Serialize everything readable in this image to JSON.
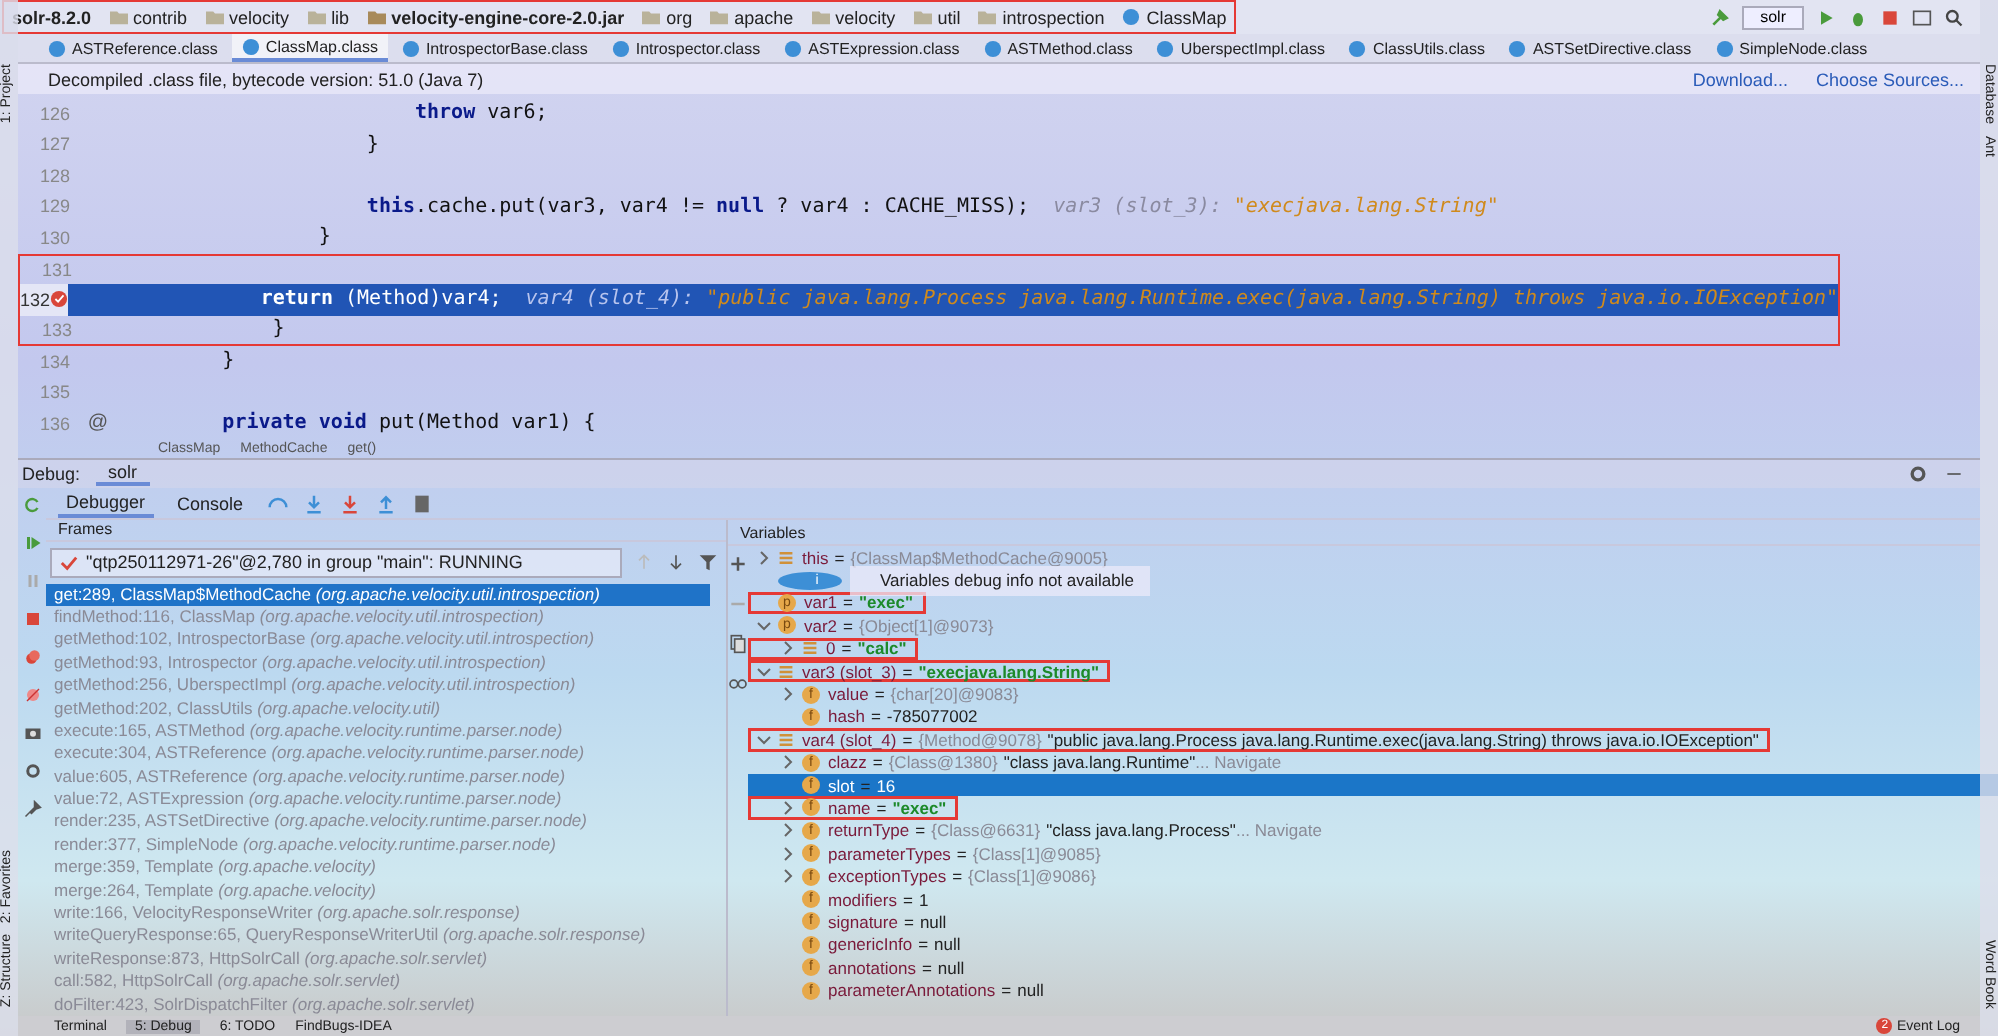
{
  "breadcrumbs": [
    {
      "label": "solr-8.2.0",
      "kind": "project"
    },
    {
      "label": "contrib",
      "kind": "folder"
    },
    {
      "label": "velocity",
      "kind": "folder"
    },
    {
      "label": "lib",
      "kind": "folder"
    },
    {
      "label": "velocity-engine-core-2.0.jar",
      "kind": "jar"
    },
    {
      "label": "org",
      "kind": "folder"
    },
    {
      "label": "apache",
      "kind": "folder"
    },
    {
      "label": "velocity",
      "kind": "folder"
    },
    {
      "label": "util",
      "kind": "folder"
    },
    {
      "label": "introspection",
      "kind": "folder"
    },
    {
      "label": "ClassMap",
      "kind": "class"
    }
  ],
  "breadcrumbs_highlighted": true,
  "run_config": "solr",
  "tabs": [
    {
      "label": "ASTReference.class",
      "selected": false
    },
    {
      "label": "ClassMap.class",
      "selected": true
    },
    {
      "label": "IntrospectorBase.class",
      "selected": false
    },
    {
      "label": "Introspector.class",
      "selected": false
    },
    {
      "label": "ASTExpression.class",
      "selected": false
    },
    {
      "label": "ASTMethod.class",
      "selected": false
    },
    {
      "label": "UberspectImpl.class",
      "selected": false
    },
    {
      "label": "ClassUtils.class",
      "selected": false
    },
    {
      "label": "ASTSetDirective.class",
      "selected": false
    },
    {
      "label": "SimpleNode.class",
      "selected": false
    }
  ],
  "info_bar": {
    "message": "Decompiled .class file, bytecode version: 51.0 (Java 7)",
    "links": [
      "Download...",
      "Choose Sources..."
    ]
  },
  "code_lines": [
    {
      "number": "126",
      "code": "                        **throw** var6;",
      "current": false
    },
    {
      "number": "127",
      "code": "                    }",
      "current": false
    },
    {
      "number": "128",
      "current": false
    },
    {
      "number": "129",
      "code": "                    **this**.cache.put(var3, var4 != **null** ? var4 : CACHE_MISS);",
      "hint_label": "var3 (slot_3):",
      "hint_value": "\"execjava.lang.String\"",
      "current": false
    },
    {
      "number": "130",
      "code": "                }",
      "current": false
    },
    {
      "number": "131",
      "current": false,
      "highlighted": true
    },
    {
      "number": "132",
      "code": "                **return** (Method)var4;",
      "hint_label": "var4 (slot_4):",
      "hint_value": "\"public java.lang.Process java.lang.Runtime.exec(java.lang.String) throws java.io.IOException\"",
      "current": true,
      "breakpoint": true,
      "highlighted": true
    },
    {
      "number": "133",
      "code": "            }",
      "current": false,
      "highlighted": true
    },
    {
      "number": "134",
      "code": "        }",
      "current": false
    },
    {
      "number": "135",
      "current": false
    },
    {
      "number": "136",
      "code": "        **private void** put(Method var1) {",
      "gutter_mark": "@",
      "current": false
    }
  ],
  "editor_path": [
    "ClassMap",
    "MethodCache",
    "get()"
  ],
  "debug": {
    "title": "Debug:",
    "session": "solr",
    "tabs": [
      {
        "label": "Debugger",
        "selected": true
      },
      {
        "label": "Console",
        "selected": false
      }
    ]
  },
  "frames": {
    "header": "Frames",
    "thread": "\"qtp250112971-26\"@2,780 in group \"main\": RUNNING",
    "items": [
      {
        "method": "get:289, ClassMap$MethodCache",
        "package": "(org.apache.velocity.util.introspection)",
        "selected": true
      },
      {
        "method": "findMethod:116, ClassMap",
        "package": "(org.apache.velocity.util.introspection)",
        "selected": false
      },
      {
        "method": "getMethod:102, IntrospectorBase",
        "package": "(org.apache.velocity.util.introspection)",
        "selected": false
      },
      {
        "method": "getMethod:93, Introspector",
        "package": "(org.apache.velocity.util.introspection)",
        "selected": false
      },
      {
        "method": "getMethod:256, UberspectImpl",
        "package": "(org.apache.velocity.util.introspection)",
        "selected": false
      },
      {
        "method": "getMethod:202, ClassUtils",
        "package": "(org.apache.velocity.util)",
        "selected": false
      },
      {
        "method": "execute:165, ASTMethod",
        "package": "(org.apache.velocity.runtime.parser.node)",
        "selected": false
      },
      {
        "method": "execute:304, ASTReference",
        "package": "(org.apache.velocity.runtime.parser.node)",
        "selected": false
      },
      {
        "method": "value:605, ASTReference",
        "package": "(org.apache.velocity.runtime.parser.node)",
        "selected": false
      },
      {
        "method": "value:72, ASTExpression",
        "package": "(org.apache.velocity.runtime.parser.node)",
        "selected": false
      },
      {
        "method": "render:235, ASTSetDirective",
        "package": "(org.apache.velocity.runtime.parser.node)",
        "selected": false
      },
      {
        "method": "render:377, SimpleNode",
        "package": "(org.apache.velocity.runtime.parser.node)",
        "selected": false
      },
      {
        "method": "merge:359, Template",
        "package": "(org.apache.velocity)",
        "selected": false
      },
      {
        "method": "merge:264, Template",
        "package": "(org.apache.velocity)",
        "selected": false
      },
      {
        "method": "write:166, VelocityResponseWriter",
        "package": "(org.apache.solr.response)",
        "selected": false
      },
      {
        "method": "writeQueryResponse:65, QueryResponseWriterUtil",
        "package": "(org.apache.solr.response)",
        "selected": false
      },
      {
        "method": "writeResponse:873, HttpSolrCall",
        "package": "(org.apache.solr.servlet)",
        "selected": false
      },
      {
        "method": "call:582, HttpSolrCall",
        "package": "(org.apache.solr.servlet)",
        "selected": false
      },
      {
        "method": "doFilter:423, SolrDispatchFilter",
        "package": "(org.apache.solr.servlet)",
        "selected": false
      }
    ]
  },
  "variables": {
    "header": "Variables",
    "items": [
      {
        "kind": "object",
        "name": "this",
        "eq": "=",
        "ref": "{ClassMap$MethodCache@9005}",
        "expanded": false,
        "selected": false,
        "highlighted": false
      },
      {
        "kind": "info",
        "badge": "i",
        "name": "Variables debug info not available",
        "selected": false,
        "highlighted": false
      },
      {
        "kind": "param",
        "badge": "p",
        "name": "var1",
        "eq": "=",
        "value": "\"exec\"",
        "quoted_string": true,
        "selected": false,
        "highlighted": true
      },
      {
        "kind": "param",
        "badge": "p",
        "name": "var2",
        "eq": "=",
        "ref": "{Object[1]@9073}",
        "expanded": true,
        "selected": false,
        "highlighted": false,
        "children": [
          {
            "kind": "object",
            "name": "0",
            "eq": "=",
            "value": "\"calc\"",
            "quoted_string": true,
            "expanded": false,
            "selected": false,
            "highlighted": true
          }
        ]
      },
      {
        "kind": "object",
        "name": "var3 (slot_3)",
        "eq": "=",
        "value": "\"execjava.lang.String\"",
        "quoted_string": true,
        "expanded": true,
        "selected": false,
        "highlighted": true,
        "children": [
          {
            "kind": "field",
            "badge": "f",
            "name": "value",
            "eq": "=",
            "ref": "{char[20]@9083}",
            "expanded": false,
            "selected": false,
            "highlighted": false
          },
          {
            "kind": "field",
            "badge": "f",
            "name": "hash",
            "eq": "=",
            "value": "-785077002",
            "quoted_string": false,
            "selected": false,
            "highlighted": false
          }
        ]
      },
      {
        "kind": "object",
        "name": "var4 (slot_4)",
        "eq": "=",
        "ref": "{Method@9078}",
        "value": "\"public java.lang.Process java.lang.Runtime.exec(java.lang.String) throws java.io.IOException\"",
        "quoted_string": false,
        "expanded": true,
        "selected": false,
        "highlighted": true,
        "children": [
          {
            "kind": "field",
            "badge": "f",
            "name": "clazz",
            "eq": "=",
            "ref": "{Class@1380}",
            "value": "\"class java.lang.Runtime\"",
            "quoted_string": false,
            "navigate": "... Navigate",
            "expanded": false,
            "selected": false,
            "highlighted": false
          },
          {
            "kind": "field",
            "badge": "f",
            "name": "slot",
            "eq": "=",
            "value": "16",
            "quoted_string": false,
            "selected": true,
            "highlighted": false
          },
          {
            "kind": "field",
            "badge": "f",
            "name": "name",
            "eq": "=",
            "value": "\"exec\"",
            "quoted_string": true,
            "expanded": false,
            "selected": false,
            "highlighted": true
          },
          {
            "kind": "field",
            "badge": "f",
            "name": "returnType",
            "eq": "=",
            "ref": "{Class@6631}",
            "value": "\"class java.lang.Process\"",
            "quoted_string": false,
            "navigate": "... Navigate",
            "expanded": false,
            "selected": false,
            "highlighted": false
          },
          {
            "kind": "field",
            "badge": "f",
            "name": "parameterTypes",
            "eq": "=",
            "ref": "{Class[1]@9085}",
            "expanded": false,
            "selected": false,
            "highlighted": false
          },
          {
            "kind": "field",
            "badge": "f",
            "name": "exceptionTypes",
            "eq": "=",
            "ref": "{Class[1]@9086}",
            "expanded": false,
            "selected": false,
            "highlighted": false
          },
          {
            "kind": "field",
            "badge": "f",
            "name": "modifiers",
            "eq": "=",
            "value": "1",
            "quoted_string": false,
            "selected": false,
            "highlighted": false
          },
          {
            "kind": "field",
            "badge": "f",
            "name": "signature",
            "eq": "=",
            "value": "null",
            "quoted_string": false,
            "selected": false,
            "highlighted": false
          },
          {
            "kind": "field",
            "badge": "f",
            "name": "genericInfo",
            "eq": "=",
            "value": "null",
            "quoted_string": false,
            "selected": false,
            "highlighted": false
          },
          {
            "kind": "field",
            "badge": "f",
            "name": "annotations",
            "eq": "=",
            "value": "null",
            "quoted_string": false,
            "selected": false,
            "highlighted": false
          },
          {
            "kind": "field",
            "badge": "f",
            "name": "parameterAnnotations",
            "eq": "=",
            "value": "null",
            "quoted_string": false,
            "selected": false,
            "highlighted": false
          }
        ]
      }
    ]
  },
  "left_strip": [
    "1: Project",
    "2: Favorites",
    "Z: Structure"
  ],
  "right_strip_top": [
    "Database",
    "Ant"
  ],
  "right_strip_bottom": [
    "Word Book"
  ],
  "status_bar": {
    "tools": [
      {
        "label": "Terminal",
        "selected": false
      },
      {
        "label": "5: Debug",
        "selected": true
      },
      {
        "label": "6: TODO",
        "selected": false
      },
      {
        "label": "FindBugs-IDEA",
        "selected": false
      }
    ],
    "event_count": "2",
    "event_label": "Event Log"
  }
}
